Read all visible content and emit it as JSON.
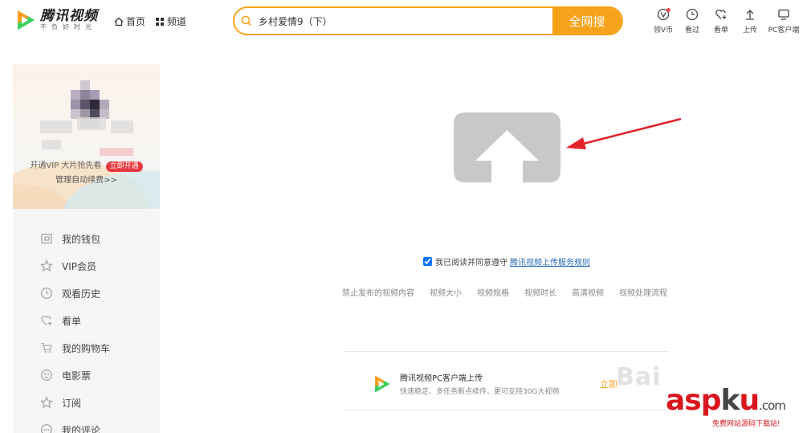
{
  "header": {
    "logo_title": "腾讯视频",
    "logo_slogan": "不负好时光",
    "nav": [
      {
        "label": "首页",
        "icon": "home-icon"
      },
      {
        "label": "频道",
        "icon": "grid-icon"
      }
    ],
    "search": {
      "value": "乡村爱情9（下）",
      "button_label": "全网搜"
    },
    "tools": [
      {
        "label": "领V币",
        "icon": "v-coin-icon"
      },
      {
        "label": "看过",
        "icon": "clock-icon"
      },
      {
        "label": "看单",
        "icon": "heart-plus-icon"
      },
      {
        "label": "上传",
        "icon": "upload-icon"
      },
      {
        "label": "PC客户端",
        "icon": "monitor-icon"
      }
    ]
  },
  "sidebar": {
    "vip_text": "开通VIP 大片抢先看",
    "vip_badge": "立即开通",
    "renew_link": "管理自动续费>>",
    "menu": [
      {
        "label": "我的钱包",
        "icon": "wallet-icon"
      },
      {
        "label": "VIP会员",
        "icon": "vip-star-icon"
      },
      {
        "label": "观看历史",
        "icon": "history-icon"
      },
      {
        "label": "看单",
        "icon": "heart-plus-icon"
      },
      {
        "label": "我的购物车",
        "icon": "cart-icon"
      },
      {
        "label": "电影票",
        "icon": "ticket-icon"
      },
      {
        "label": "订阅",
        "icon": "star-icon"
      },
      {
        "label": "我的评论",
        "icon": "comment-icon"
      }
    ]
  },
  "main": {
    "agree_text": "我已阅读并同意遵守",
    "agree_link": "腾讯视频上传服务规则",
    "links": [
      "禁止发布的视频内容",
      "视频大小",
      "视频规格",
      "视频时长",
      "高清视频",
      "视频处理流程"
    ],
    "client_title": "腾讯视频PC客户端上传",
    "client_desc": "快速稳定、多任务断点续传、更可支持30G大视频",
    "client_button": "立即"
  },
  "watermarks": {
    "baidu": "Bai",
    "asp_main_a": "asp",
    "asp_main_k": "k",
    "asp_main_u": "u",
    "asp_main_com": ".com",
    "asp_sub": "免费网站源码下载站!"
  },
  "colors": {
    "accent": "#f7a21b",
    "vip_red": "#e6383f",
    "link_blue": "#2a6eb8",
    "arrow_red": "#e2222b"
  }
}
